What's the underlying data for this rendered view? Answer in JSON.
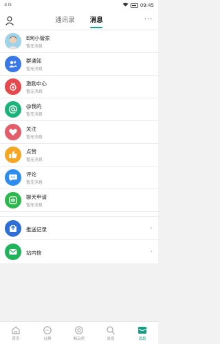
{
  "status_bar": {
    "left_text": "4G",
    "time": "09:45"
  },
  "header": {
    "tabs": [
      {
        "label": "通讯录"
      },
      {
        "label": "消息"
      }
    ],
    "more_label": "···"
  },
  "messages": [
    {
      "title": "E网小管家",
      "subtitle": "暂无消息",
      "icon": "avatar",
      "color": "#b0bec5"
    },
    {
      "title": "群通知",
      "subtitle": "暂无消息",
      "icon": "group-icon",
      "color": "#3b78e7"
    },
    {
      "title": "激励中心",
      "subtitle": "暂无消息",
      "icon": "medal-icon",
      "color": "#e5484d"
    },
    {
      "title": "@我的",
      "subtitle": "暂无消息",
      "icon": "at-icon",
      "color": "#1bb37a"
    },
    {
      "title": "关注",
      "subtitle": "暂无消息",
      "icon": "heart-icon",
      "color": "#e35d6a"
    },
    {
      "title": "点赞",
      "subtitle": "暂无消息",
      "icon": "thumb-up-icon",
      "color": "#f5a623"
    },
    {
      "title": "评论",
      "subtitle": "暂无消息",
      "icon": "comment-icon",
      "color": "#2d8cf0"
    },
    {
      "title": "聊天申请",
      "subtitle": "暂无消息",
      "icon": "chat-request-icon",
      "color": "#2db84d"
    }
  ],
  "links": [
    {
      "title": "推送记录",
      "icon": "push-record-icon",
      "color": "#2d6fd6",
      "chevron": "›"
    },
    {
      "title": "站内信",
      "icon": "mail-icon",
      "color": "#21b35b",
      "chevron": "›"
    }
  ],
  "bottom_nav": [
    {
      "label": "首页",
      "icon": "home-icon"
    },
    {
      "label": "社群",
      "icon": "community-icon"
    },
    {
      "label": "畅玩吧",
      "icon": "play-icon"
    },
    {
      "label": "发现",
      "icon": "discover-icon"
    },
    {
      "label": "消息",
      "icon": "message-icon",
      "active": true
    }
  ],
  "colors": {
    "accent": "#16a085"
  }
}
